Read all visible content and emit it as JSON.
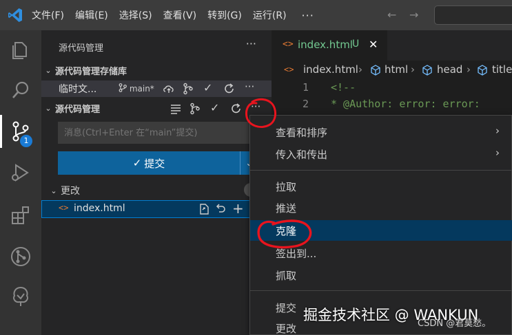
{
  "titlebar": {
    "menus": [
      "文件(F)",
      "编辑(E)",
      "选择(S)",
      "查看(V)",
      "转到(G)",
      "运行(R)"
    ],
    "more": "···",
    "back_icon": "arrow-left-icon",
    "forward_icon": "arrow-right-icon"
  },
  "activitybar": {
    "icons": [
      "explorer-icon",
      "search-icon",
      "source-control-icon",
      "run-debug-icon",
      "extensions-icon",
      "git-graph-icon",
      "tree-icon"
    ],
    "scm_badge": "1",
    "accent": "#1a7bd6"
  },
  "sidebar": {
    "title": "源代码管理",
    "more": "···",
    "repos_section_label": "源代码管理存储库",
    "repo_name": "临时文...",
    "repo_branch": "main*",
    "scm_section_label": "源代码管理",
    "commit_placeholder": "消息(Ctrl+Enter 在“main”提交)",
    "commit_button_label": "提交",
    "changes_label": "更改",
    "file_name": "index.html"
  },
  "editor": {
    "tab_label": "index.html",
    "tab_flag": "U",
    "breadcrumb": [
      "index.html",
      "html",
      "head",
      "title"
    ],
    "lines": [
      {
        "n": "1",
        "text": "<!--"
      },
      {
        "n": "2",
        "text": " * @Author: error: error:"
      }
    ]
  },
  "context_menu": {
    "items": [
      {
        "label": "查看和排序",
        "submenu": true
      },
      {
        "label": "传入和传出",
        "submenu": true
      },
      {
        "label": "拉取"
      },
      {
        "label": "推送"
      },
      {
        "label": "克隆",
        "highlighted": true
      },
      {
        "label": "签出到..."
      },
      {
        "label": "抓取"
      },
      {
        "label": "提交"
      },
      {
        "label": "更改"
      }
    ],
    "highlight_color": "#04395e"
  },
  "watermark": {
    "main": "掘金技术社区 @ WANKUN",
    "sub": "CSDN @君莫愁。"
  }
}
